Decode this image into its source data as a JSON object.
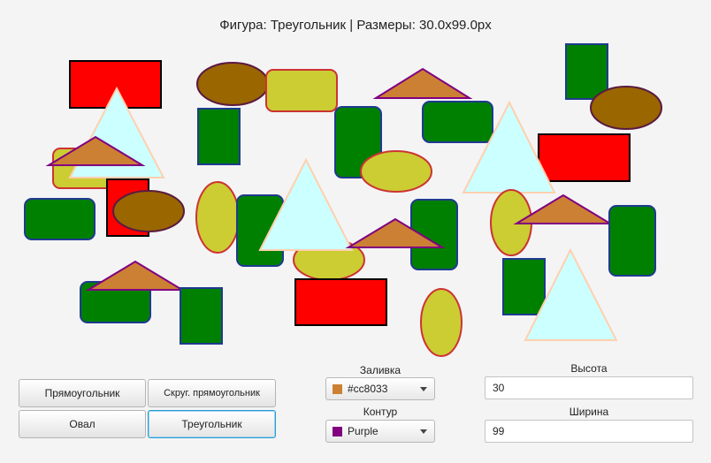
{
  "header": {
    "title": "Фигура: Треугольник | Размеры: 30.0x99.0px"
  },
  "shape_buttons": {
    "rectangle": "Прямоугольник",
    "rounded_rectangle": "Скруг. прямоугольник",
    "oval": "Овал",
    "triangle": "Треугольник",
    "selected": "triangle"
  },
  "fill": {
    "label": "Заливка",
    "value": "#cc8033",
    "swatch": "#cc8033"
  },
  "stroke": {
    "label": "Контур",
    "value": "Purple",
    "swatch": "#800080"
  },
  "height": {
    "label": "Высота",
    "value": "30"
  },
  "width": {
    "label": "Ширина",
    "value": "99"
  },
  "palette": {
    "red": "#ff0000",
    "green": "#008000",
    "oval_brown": "#996600",
    "oval_yellow": "#cccc33",
    "triangle_cyan": "#ccffff",
    "triangle_orange": "#cc8033",
    "black": "#000000",
    "navy": "#1f3a8f",
    "crimson": "#cc3333",
    "purple": "#800080",
    "peach": "#ffd0b0",
    "dark_purple": "#5a1a40"
  }
}
